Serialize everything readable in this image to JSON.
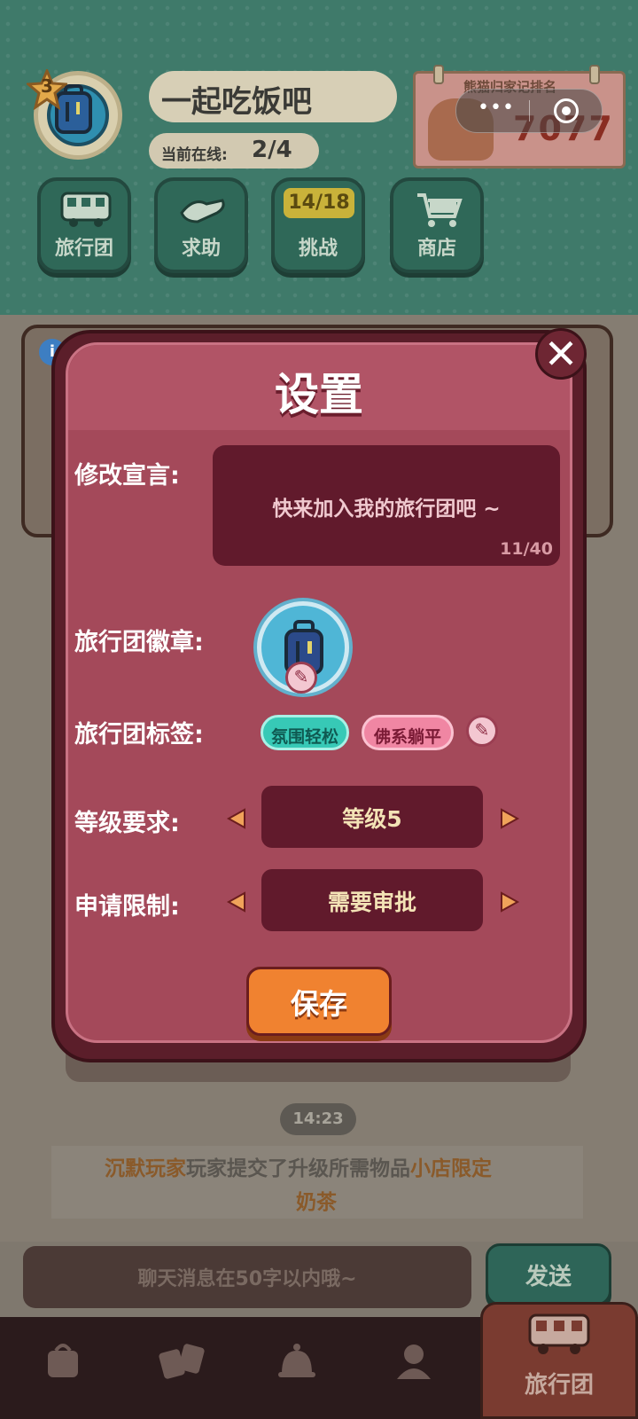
{
  "header": {
    "guild_level": "3",
    "guild_name": "一起吃饭吧",
    "online_label": "当前在线:",
    "online_value": "2/4",
    "rank_title": "熊猫归家记排名",
    "rank_value": "7077"
  },
  "menu": {
    "items": [
      {
        "label": "旅行团",
        "icon": "bus-icon"
      },
      {
        "label": "求助",
        "icon": "handshake-icon"
      },
      {
        "label": "挑战",
        "icon": "challenge-icon",
        "badge": "14/18"
      },
      {
        "label": "商店",
        "icon": "cart-icon"
      }
    ]
  },
  "dialog": {
    "title": "设置",
    "close_label": "✕",
    "motto_label": "修改宣言:",
    "motto_text": "快来加入我的旅行团吧 ~",
    "motto_count": "11/40",
    "badge_label": "旅行团徽章:",
    "tags_label": "旅行团标签:",
    "tags": [
      "氛围轻松",
      "佛系躺平"
    ],
    "level_label": "等级要求:",
    "level_value": "等级5",
    "apply_label": "申请限制:",
    "apply_value": "需要审批",
    "save_label": "保存"
  },
  "chat": {
    "time": "14:23",
    "message_player": "沉默玩家",
    "message_mid": "玩家提交了升级所需物品",
    "message_item_a": "小店限定",
    "message_item_b": "奶茶",
    "input_placeholder": "聊天消息在50字以内哦~",
    "send_label": "发送"
  },
  "nav": {
    "items": [
      {
        "icon": "bag-icon"
      },
      {
        "icon": "cards-icon"
      },
      {
        "icon": "bell-icon"
      },
      {
        "icon": "profile-icon"
      }
    ],
    "active_label": "旅行团",
    "active_icon": "bus-icon"
  },
  "colors": {
    "dialog_bg": "#a4495a",
    "dialog_dark": "#611a2c",
    "save_orange": "#f08230",
    "teal_tag": "#37c9b6",
    "pink_tag": "#f086a3"
  }
}
